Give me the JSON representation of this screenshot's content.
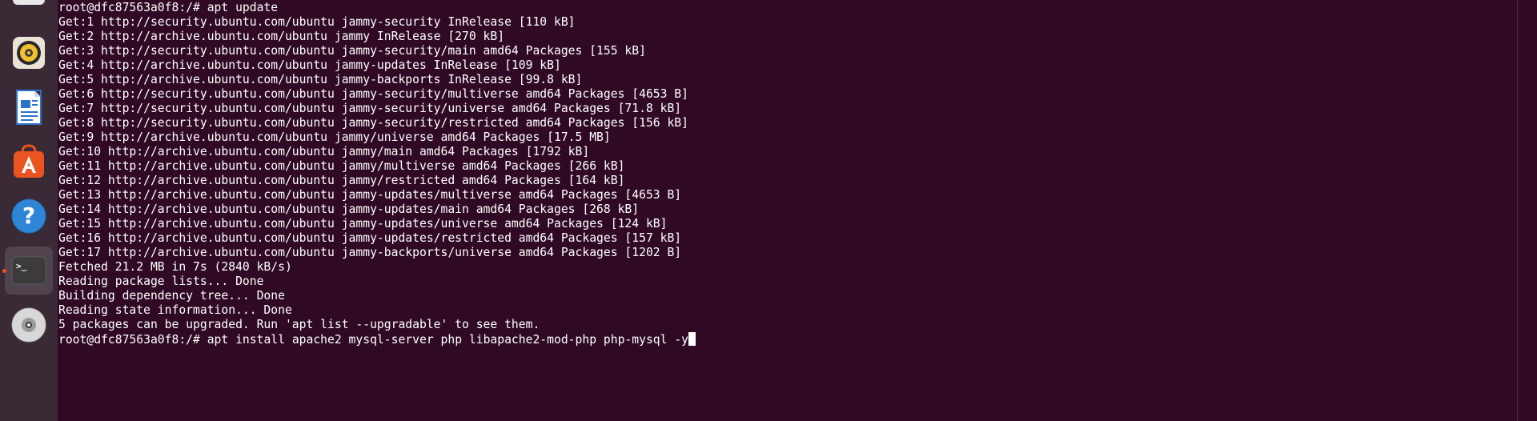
{
  "dock": {
    "items": [
      {
        "name": "files",
        "icon": "files-icon"
      },
      {
        "name": "rhythmbox",
        "icon": "rhythmbox-speaker-icon"
      },
      {
        "name": "libreoffice-writer",
        "icon": "writer-document-icon"
      },
      {
        "name": "app-center",
        "icon": "app-store-icon"
      },
      {
        "name": "help",
        "icon": "help-question-icon",
        "glyph": "?"
      },
      {
        "name": "terminal",
        "icon": "terminal-icon",
        "glyph": ">_",
        "active": true
      },
      {
        "name": "optical-drive",
        "icon": "disc-icon"
      }
    ]
  },
  "terminal": {
    "lines": [
      "root@dfc87563a0f8:/# apt update",
      "Get:1 http://security.ubuntu.com/ubuntu jammy-security InRelease [110 kB]",
      "Get:2 http://archive.ubuntu.com/ubuntu jammy InRelease [270 kB]",
      "Get:3 http://security.ubuntu.com/ubuntu jammy-security/main amd64 Packages [155 kB]",
      "Get:4 http://archive.ubuntu.com/ubuntu jammy-updates InRelease [109 kB]",
      "Get:5 http://archive.ubuntu.com/ubuntu jammy-backports InRelease [99.8 kB]",
      "Get:6 http://security.ubuntu.com/ubuntu jammy-security/multiverse amd64 Packages [4653 B]",
      "Get:7 http://security.ubuntu.com/ubuntu jammy-security/universe amd64 Packages [71.8 kB]",
      "Get:8 http://security.ubuntu.com/ubuntu jammy-security/restricted amd64 Packages [156 kB]",
      "Get:9 http://archive.ubuntu.com/ubuntu jammy/universe amd64 Packages [17.5 MB]",
      "Get:10 http://archive.ubuntu.com/ubuntu jammy/main amd64 Packages [1792 kB]",
      "Get:11 http://archive.ubuntu.com/ubuntu jammy/multiverse amd64 Packages [266 kB]",
      "Get:12 http://archive.ubuntu.com/ubuntu jammy/restricted amd64 Packages [164 kB]",
      "Get:13 http://archive.ubuntu.com/ubuntu jammy-updates/multiverse amd64 Packages [4653 B]",
      "Get:14 http://archive.ubuntu.com/ubuntu jammy-updates/main amd64 Packages [268 kB]",
      "Get:15 http://archive.ubuntu.com/ubuntu jammy-updates/universe amd64 Packages [124 kB]",
      "Get:16 http://archive.ubuntu.com/ubuntu jammy-updates/restricted amd64 Packages [157 kB]",
      "Get:17 http://archive.ubuntu.com/ubuntu jammy-backports/universe amd64 Packages [1202 B]",
      "Fetched 21.2 MB in 7s (2840 kB/s)",
      "Reading package lists... Done",
      "Building dependency tree... Done",
      "Reading state information... Done",
      "5 packages can be upgraded. Run 'apt list --upgradable' to see them."
    ],
    "prompt": "root@dfc87563a0f8:/# ",
    "current_input": "apt install apache2 mysql-server php libapache2-mod-php php-mysql -y"
  },
  "colors": {
    "terminal_bg": "#300a24",
    "dock_bg": "#3a2a35",
    "accent": "#e95420",
    "text": "#ffffff"
  }
}
